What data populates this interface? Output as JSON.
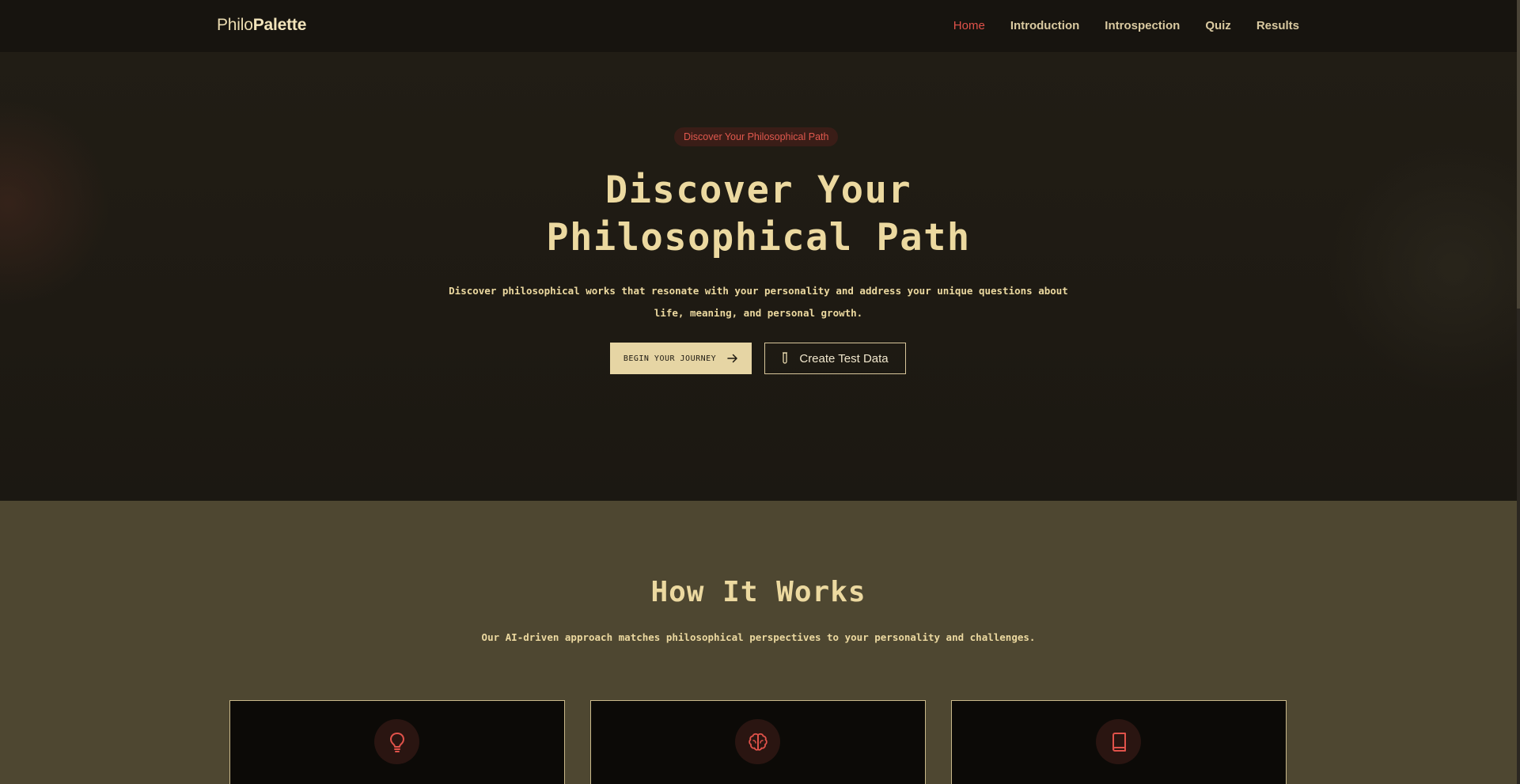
{
  "nav": {
    "logo_light": "Philo",
    "logo_bold": "Palette",
    "links": [
      {
        "label": "Home",
        "active": true
      },
      {
        "label": "Introduction",
        "active": false
      },
      {
        "label": "Introspection",
        "active": false
      },
      {
        "label": "Quiz",
        "active": false
      },
      {
        "label": "Results",
        "active": false
      }
    ]
  },
  "hero": {
    "badge": "Discover Your Philosophical Path",
    "title": "Discover Your Philosophical Path",
    "subtitle": "Discover philosophical works that resonate with your personality and address your unique questions about life, meaning, and personal growth.",
    "primary_button": "BEGIN YOUR JOURNEY",
    "primary_icon": "arrow-right-icon",
    "secondary_button": "Create Test Data",
    "secondary_icon": "test-tube-icon"
  },
  "how": {
    "title": "How It Works",
    "subtitle": "Our AI-driven approach matches philosophical perspectives to your personality and challenges.",
    "cards": [
      {
        "icon": "lightbulb-icon"
      },
      {
        "icon": "brain-icon"
      },
      {
        "icon": "book-icon"
      }
    ]
  },
  "colors": {
    "accent": "#e0524a",
    "cream": "#ecd9a0",
    "hero_bg": "#1e1a13",
    "section_bg": "#4e4731"
  }
}
